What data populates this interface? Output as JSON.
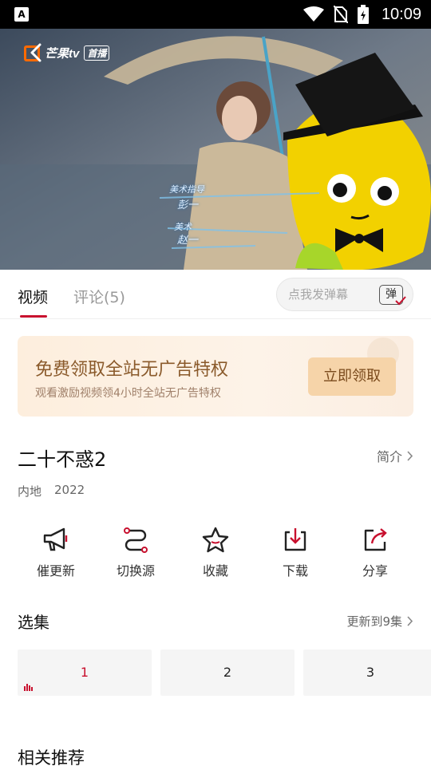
{
  "status_bar": {
    "time": "10:09",
    "left_badge": "A",
    "icons": [
      "wifi-icon",
      "no-sim-icon",
      "battery-icon"
    ]
  },
  "player": {
    "logo_text": "芒果tv",
    "logo_badge": "首播",
    "credits": [
      {
        "role": "美术指导",
        "name": "彭一"
      },
      {
        "role": "美术",
        "name": "赵一"
      }
    ]
  },
  "tabs": [
    {
      "label": "视频",
      "active": true
    },
    {
      "label": "评论(5)",
      "active": false
    }
  ],
  "danmaku": {
    "placeholder": "点我发弹幕",
    "button_label": "弹"
  },
  "promo": {
    "title": "免费领取全站无广告特权",
    "subtitle": "观看激励视频领4小时全站无广告特权",
    "button": "立即领取"
  },
  "show": {
    "title": "二十不惑2",
    "intro_link": "简介",
    "region": "内地",
    "year": "2022"
  },
  "actions": [
    {
      "label": "催更新",
      "icon": "megaphone-icon"
    },
    {
      "label": "切换源",
      "icon": "switch-source-icon"
    },
    {
      "label": "收藏",
      "icon": "star-icon"
    },
    {
      "label": "下载",
      "icon": "download-icon"
    },
    {
      "label": "分享",
      "icon": "share-icon"
    }
  ],
  "episodes": {
    "title": "选集",
    "update_text": "更新到9集",
    "items": [
      "1",
      "2",
      "3"
    ],
    "playing": "1"
  },
  "recommend_title": "相关推荐",
  "colors": {
    "accent": "#c8102e",
    "promo_text": "#8a5a2b",
    "promo_button": "#f6d4a9"
  }
}
